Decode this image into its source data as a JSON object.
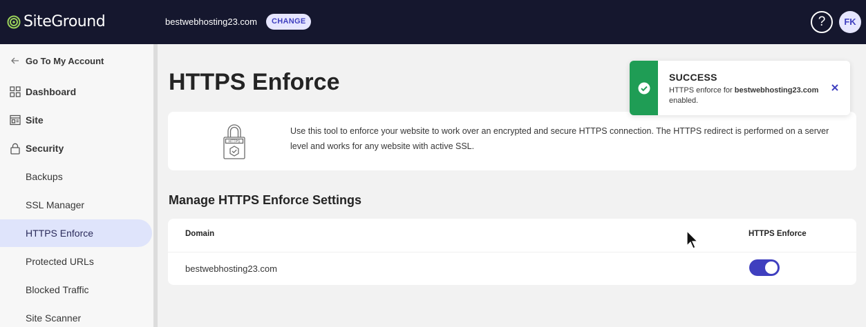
{
  "header": {
    "logo_text": "SiteGround",
    "site_domain": "bestwebhosting23.com",
    "change_label": "CHANGE",
    "help_label": "?",
    "avatar_initials": "FK"
  },
  "sidebar": {
    "back_label": "Go To My Account",
    "items": [
      {
        "label": "Dashboard",
        "icon": "dashboard-grid-icon"
      },
      {
        "label": "Site",
        "icon": "site-window-icon"
      },
      {
        "label": "Security",
        "icon": "lock-icon"
      }
    ],
    "sub_items": [
      {
        "label": "Backups"
      },
      {
        "label": "SSL Manager"
      },
      {
        "label": "HTTPS Enforce",
        "active": true
      },
      {
        "label": "Protected URLs"
      },
      {
        "label": "Blocked Traffic"
      },
      {
        "label": "Site Scanner"
      }
    ]
  },
  "main": {
    "title": "HTTPS Enforce",
    "info_icon_label": "HTTPS",
    "info_text": "Use this tool to enforce your website to work over an encrypted and secure HTTPS connection. The HTTPS redirect is performed on a server level and works for any website with active SSL.",
    "section_title": "Manage HTTPS Enforce Settings",
    "table": {
      "headers": [
        "Domain",
        "HTTPS Enforce"
      ],
      "rows": [
        {
          "domain": "bestwebhosting23.com",
          "enforced": true
        }
      ]
    }
  },
  "toast": {
    "title": "SUCCESS",
    "message_prefix": "HTTPS enforce for ",
    "message_domain": "bestwebhosting23.com",
    "message_suffix": " enabled."
  },
  "colors": {
    "topbar": "#15172e",
    "accent": "#3f3fbf",
    "success": "#1f9d55",
    "active_nav": "#dfe4fb"
  }
}
